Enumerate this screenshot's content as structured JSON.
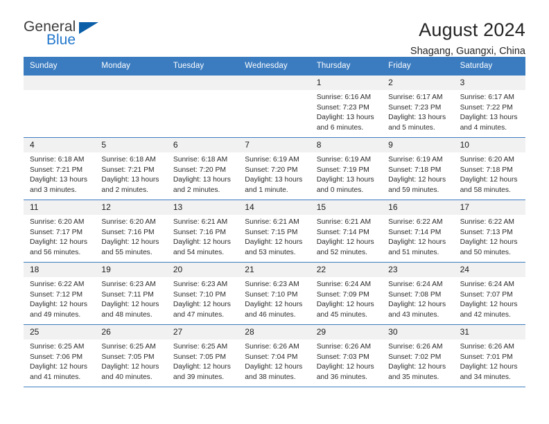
{
  "logo": {
    "text_top": "General",
    "text_bottom": "Blue",
    "accent_color": "#0b5ea8",
    "blue_color": "#2277cc"
  },
  "header": {
    "title": "August 2024",
    "location": "Shagang, Guangxi, China"
  },
  "theme": {
    "header_blue": "#3b7cc0",
    "daynum_gray": "#f1f1f1"
  },
  "weekdays": [
    "Sunday",
    "Monday",
    "Tuesday",
    "Wednesday",
    "Thursday",
    "Friday",
    "Saturday"
  ],
  "weeks": [
    [
      {
        "day": "",
        "sunrise": "",
        "sunset": "",
        "daylight1": "",
        "daylight2": ""
      },
      {
        "day": "",
        "sunrise": "",
        "sunset": "",
        "daylight1": "",
        "daylight2": ""
      },
      {
        "day": "",
        "sunrise": "",
        "sunset": "",
        "daylight1": "",
        "daylight2": ""
      },
      {
        "day": "",
        "sunrise": "",
        "sunset": "",
        "daylight1": "",
        "daylight2": ""
      },
      {
        "day": "1",
        "sunrise": "Sunrise: 6:16 AM",
        "sunset": "Sunset: 7:23 PM",
        "daylight1": "Daylight: 13 hours",
        "daylight2": "and 6 minutes."
      },
      {
        "day": "2",
        "sunrise": "Sunrise: 6:17 AM",
        "sunset": "Sunset: 7:23 PM",
        "daylight1": "Daylight: 13 hours",
        "daylight2": "and 5 minutes."
      },
      {
        "day": "3",
        "sunrise": "Sunrise: 6:17 AM",
        "sunset": "Sunset: 7:22 PM",
        "daylight1": "Daylight: 13 hours",
        "daylight2": "and 4 minutes."
      }
    ],
    [
      {
        "day": "4",
        "sunrise": "Sunrise: 6:18 AM",
        "sunset": "Sunset: 7:21 PM",
        "daylight1": "Daylight: 13 hours",
        "daylight2": "and 3 minutes."
      },
      {
        "day": "5",
        "sunrise": "Sunrise: 6:18 AM",
        "sunset": "Sunset: 7:21 PM",
        "daylight1": "Daylight: 13 hours",
        "daylight2": "and 2 minutes."
      },
      {
        "day": "6",
        "sunrise": "Sunrise: 6:18 AM",
        "sunset": "Sunset: 7:20 PM",
        "daylight1": "Daylight: 13 hours",
        "daylight2": "and 2 minutes."
      },
      {
        "day": "7",
        "sunrise": "Sunrise: 6:19 AM",
        "sunset": "Sunset: 7:20 PM",
        "daylight1": "Daylight: 13 hours",
        "daylight2": "and 1 minute."
      },
      {
        "day": "8",
        "sunrise": "Sunrise: 6:19 AM",
        "sunset": "Sunset: 7:19 PM",
        "daylight1": "Daylight: 13 hours",
        "daylight2": "and 0 minutes."
      },
      {
        "day": "9",
        "sunrise": "Sunrise: 6:19 AM",
        "sunset": "Sunset: 7:18 PM",
        "daylight1": "Daylight: 12 hours",
        "daylight2": "and 59 minutes."
      },
      {
        "day": "10",
        "sunrise": "Sunrise: 6:20 AM",
        "sunset": "Sunset: 7:18 PM",
        "daylight1": "Daylight: 12 hours",
        "daylight2": "and 58 minutes."
      }
    ],
    [
      {
        "day": "11",
        "sunrise": "Sunrise: 6:20 AM",
        "sunset": "Sunset: 7:17 PM",
        "daylight1": "Daylight: 12 hours",
        "daylight2": "and 56 minutes."
      },
      {
        "day": "12",
        "sunrise": "Sunrise: 6:20 AM",
        "sunset": "Sunset: 7:16 PM",
        "daylight1": "Daylight: 12 hours",
        "daylight2": "and 55 minutes."
      },
      {
        "day": "13",
        "sunrise": "Sunrise: 6:21 AM",
        "sunset": "Sunset: 7:16 PM",
        "daylight1": "Daylight: 12 hours",
        "daylight2": "and 54 minutes."
      },
      {
        "day": "14",
        "sunrise": "Sunrise: 6:21 AM",
        "sunset": "Sunset: 7:15 PM",
        "daylight1": "Daylight: 12 hours",
        "daylight2": "and 53 minutes."
      },
      {
        "day": "15",
        "sunrise": "Sunrise: 6:21 AM",
        "sunset": "Sunset: 7:14 PM",
        "daylight1": "Daylight: 12 hours",
        "daylight2": "and 52 minutes."
      },
      {
        "day": "16",
        "sunrise": "Sunrise: 6:22 AM",
        "sunset": "Sunset: 7:14 PM",
        "daylight1": "Daylight: 12 hours",
        "daylight2": "and 51 minutes."
      },
      {
        "day": "17",
        "sunrise": "Sunrise: 6:22 AM",
        "sunset": "Sunset: 7:13 PM",
        "daylight1": "Daylight: 12 hours",
        "daylight2": "and 50 minutes."
      }
    ],
    [
      {
        "day": "18",
        "sunrise": "Sunrise: 6:22 AM",
        "sunset": "Sunset: 7:12 PM",
        "daylight1": "Daylight: 12 hours",
        "daylight2": "and 49 minutes."
      },
      {
        "day": "19",
        "sunrise": "Sunrise: 6:23 AM",
        "sunset": "Sunset: 7:11 PM",
        "daylight1": "Daylight: 12 hours",
        "daylight2": "and 48 minutes."
      },
      {
        "day": "20",
        "sunrise": "Sunrise: 6:23 AM",
        "sunset": "Sunset: 7:10 PM",
        "daylight1": "Daylight: 12 hours",
        "daylight2": "and 47 minutes."
      },
      {
        "day": "21",
        "sunrise": "Sunrise: 6:23 AM",
        "sunset": "Sunset: 7:10 PM",
        "daylight1": "Daylight: 12 hours",
        "daylight2": "and 46 minutes."
      },
      {
        "day": "22",
        "sunrise": "Sunrise: 6:24 AM",
        "sunset": "Sunset: 7:09 PM",
        "daylight1": "Daylight: 12 hours",
        "daylight2": "and 45 minutes."
      },
      {
        "day": "23",
        "sunrise": "Sunrise: 6:24 AM",
        "sunset": "Sunset: 7:08 PM",
        "daylight1": "Daylight: 12 hours",
        "daylight2": "and 43 minutes."
      },
      {
        "day": "24",
        "sunrise": "Sunrise: 6:24 AM",
        "sunset": "Sunset: 7:07 PM",
        "daylight1": "Daylight: 12 hours",
        "daylight2": "and 42 minutes."
      }
    ],
    [
      {
        "day": "25",
        "sunrise": "Sunrise: 6:25 AM",
        "sunset": "Sunset: 7:06 PM",
        "daylight1": "Daylight: 12 hours",
        "daylight2": "and 41 minutes."
      },
      {
        "day": "26",
        "sunrise": "Sunrise: 6:25 AM",
        "sunset": "Sunset: 7:05 PM",
        "daylight1": "Daylight: 12 hours",
        "daylight2": "and 40 minutes."
      },
      {
        "day": "27",
        "sunrise": "Sunrise: 6:25 AM",
        "sunset": "Sunset: 7:05 PM",
        "daylight1": "Daylight: 12 hours",
        "daylight2": "and 39 minutes."
      },
      {
        "day": "28",
        "sunrise": "Sunrise: 6:26 AM",
        "sunset": "Sunset: 7:04 PM",
        "daylight1": "Daylight: 12 hours",
        "daylight2": "and 38 minutes."
      },
      {
        "day": "29",
        "sunrise": "Sunrise: 6:26 AM",
        "sunset": "Sunset: 7:03 PM",
        "daylight1": "Daylight: 12 hours",
        "daylight2": "and 36 minutes."
      },
      {
        "day": "30",
        "sunrise": "Sunrise: 6:26 AM",
        "sunset": "Sunset: 7:02 PM",
        "daylight1": "Daylight: 12 hours",
        "daylight2": "and 35 minutes."
      },
      {
        "day": "31",
        "sunrise": "Sunrise: 6:26 AM",
        "sunset": "Sunset: 7:01 PM",
        "daylight1": "Daylight: 12 hours",
        "daylight2": "and 34 minutes."
      }
    ]
  ]
}
